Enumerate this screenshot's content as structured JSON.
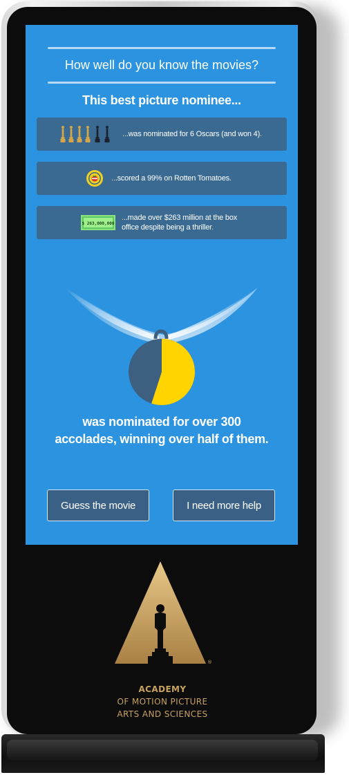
{
  "screen": {
    "headline": "How well do you know the movies?",
    "subhead": "This best picture nominee...",
    "clues": [
      {
        "icon": "oscar-statuettes-icon",
        "text": "...was nominated for 6 Oscars (and won 4).",
        "nominations": 6,
        "wins": 4
      },
      {
        "icon": "rotten-tomatoes-icon",
        "text": "...scored a 99% on Rotten Tomatoes."
      },
      {
        "icon": "dollar-bill-icon",
        "text_line1": "...made over $263 million at the box",
        "text_line2": "office despite being a thriller.",
        "bill_label": "$ 263,000,000"
      }
    ],
    "medal": {
      "icon": "medal-pie-icon",
      "won_fraction": 0.55
    },
    "tagline_line1": "was nominated for over 300",
    "tagline_line2": "accolades, winning over half of them.",
    "buttons": {
      "guess_label": "Guess the movie",
      "help_label": "I need more help"
    }
  },
  "logo": {
    "line1": "ACADEMY",
    "line2": "OF MOTION PICTURE",
    "line3": "ARTS AND SCIENCES",
    "registered": "®"
  },
  "colors": {
    "screen_bg": "#2b93e0",
    "card_bg": "#3a6a91",
    "gold": "#c9a25f",
    "pie_won": "#ffd400",
    "pie_rest": "#3d5f80"
  }
}
